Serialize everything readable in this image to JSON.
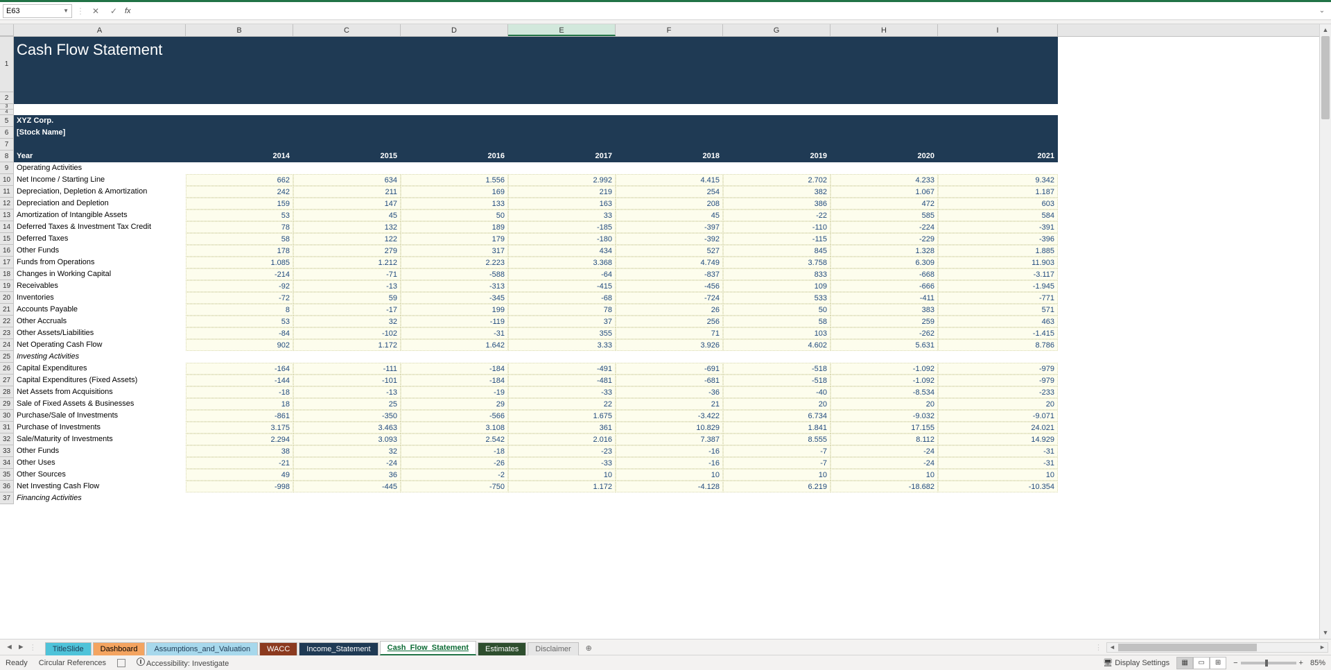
{
  "name_box": "E63",
  "formula_value": "",
  "columns": [
    "A",
    "B",
    "C",
    "D",
    "E",
    "F",
    "G",
    "H",
    "I"
  ],
  "active_column": "E",
  "title": "Cash Flow Statement",
  "company": "XYZ Corp.",
  "stock_label": "[Stock Name]",
  "year_label": "Year",
  "years": [
    "2014",
    "2015",
    "2016",
    "2017",
    "2018",
    "2019",
    "2020",
    "2021"
  ],
  "sections": {
    "operating": "Operating Activities",
    "investing": "Investing Activities",
    "financing": "Financing Activities"
  },
  "rows": [
    {
      "n": 10,
      "label": "Net Income / Starting Line",
      "vals": [
        "662",
        "634",
        "1.556",
        "2.992",
        "4.415",
        "2.702",
        "4.233",
        "9.342"
      ]
    },
    {
      "n": 11,
      "label": "Depreciation, Depletion & Amortization",
      "vals": [
        "242",
        "211",
        "169",
        "219",
        "254",
        "382",
        "1.067",
        "1.187"
      ]
    },
    {
      "n": 12,
      "label": "Depreciation and Depletion",
      "vals": [
        "159",
        "147",
        "133",
        "163",
        "208",
        "386",
        "472",
        "603"
      ]
    },
    {
      "n": 13,
      "label": "Amortization of Intangible Assets",
      "vals": [
        "53",
        "45",
        "50",
        "33",
        "45",
        "-22",
        "585",
        "584"
      ]
    },
    {
      "n": 14,
      "label": "Deferred Taxes & Investment Tax Credit",
      "vals": [
        "78",
        "132",
        "189",
        "-185",
        "-397",
        "-110",
        "-224",
        "-391"
      ]
    },
    {
      "n": 15,
      "label": "Deferred Taxes",
      "vals": [
        "58",
        "122",
        "179",
        "-180",
        "-392",
        "-115",
        "-229",
        "-396"
      ]
    },
    {
      "n": 16,
      "label": "Other Funds",
      "vals": [
        "178",
        "279",
        "317",
        "434",
        "527",
        "845",
        "1.328",
        "1.885"
      ]
    },
    {
      "n": 17,
      "label": "Funds from Operations",
      "vals": [
        "1.085",
        "1.212",
        "2.223",
        "3.368",
        "4.749",
        "3.758",
        "6.309",
        "11.903"
      ]
    },
    {
      "n": 18,
      "label": "Changes in Working Capital",
      "vals": [
        "-214",
        "-71",
        "-588",
        "-64",
        "-837",
        "833",
        "-668",
        "-3.117"
      ]
    },
    {
      "n": 19,
      "label": "Receivables",
      "vals": [
        "-92",
        "-13",
        "-313",
        "-415",
        "-456",
        "109",
        "-666",
        "-1.945"
      ]
    },
    {
      "n": 20,
      "label": "Inventories",
      "vals": [
        "-72",
        "59",
        "-345",
        "-68",
        "-724",
        "533",
        "-411",
        "-771"
      ]
    },
    {
      "n": 21,
      "label": "Accounts Payable",
      "vals": [
        "8",
        "-17",
        "199",
        "78",
        "26",
        "50",
        "383",
        "571"
      ]
    },
    {
      "n": 22,
      "label": "Other Accruals",
      "vals": [
        "53",
        "32",
        "-119",
        "37",
        "256",
        "58",
        "259",
        "463"
      ]
    },
    {
      "n": 23,
      "label": "Other Assets/Liabilities",
      "vals": [
        "-84",
        "-102",
        "-31",
        "355",
        "71",
        "103",
        "-262",
        "-1.415"
      ]
    },
    {
      "n": 24,
      "label": "Net Operating Cash Flow",
      "vals": [
        "902",
        "1.172",
        "1.642",
        "3.33",
        "3.926",
        "4.602",
        "5.631",
        "8.786"
      ]
    }
  ],
  "rows_inv": [
    {
      "n": 26,
      "label": "Capital Expenditures",
      "vals": [
        "-164",
        "-111",
        "-184",
        "-491",
        "-691",
        "-518",
        "-1.092",
        "-979"
      ]
    },
    {
      "n": 27,
      "label": "Capital Expenditures (Fixed Assets)",
      "vals": [
        "-144",
        "-101",
        "-184",
        "-481",
        "-681",
        "-518",
        "-1.092",
        "-979"
      ]
    },
    {
      "n": 28,
      "label": "Net Assets from Acquisitions",
      "vals": [
        "-18",
        "-13",
        "-19",
        "-33",
        "-36",
        "-40",
        "-8.534",
        "-233"
      ]
    },
    {
      "n": 29,
      "label": "Sale of Fixed Assets & Businesses",
      "vals": [
        "18",
        "25",
        "29",
        "22",
        "21",
        "20",
        "20",
        "20"
      ]
    },
    {
      "n": 30,
      "label": "Purchase/Sale of Investments",
      "vals": [
        "-861",
        "-350",
        "-566",
        "1.675",
        "-3.422",
        "6.734",
        "-9.032",
        "-9.071"
      ]
    },
    {
      "n": 31,
      "label": "Purchase of Investments",
      "vals": [
        "3.175",
        "3.463",
        "3.108",
        "361",
        "10.829",
        "1.841",
        "17.155",
        "24.021"
      ]
    },
    {
      "n": 32,
      "label": "Sale/Maturity of Investments",
      "vals": [
        "2.294",
        "3.093",
        "2.542",
        "2.016",
        "7.387",
        "8.555",
        "8.112",
        "14.929"
      ]
    },
    {
      "n": 33,
      "label": "Other Funds",
      "vals": [
        "38",
        "32",
        "-18",
        "-23",
        "-16",
        "-7",
        "-24",
        "-31"
      ]
    },
    {
      "n": 34,
      "label": "Other Uses",
      "vals": [
        "-21",
        "-24",
        "-26",
        "-33",
        "-16",
        "-7",
        "-24",
        "-31"
      ]
    },
    {
      "n": 35,
      "label": "Other Sources",
      "vals": [
        "49",
        "36",
        "-2",
        "10",
        "10",
        "10",
        "10",
        "10"
      ]
    },
    {
      "n": 36,
      "label": "Net Investing Cash Flow",
      "vals": [
        "-998",
        "-445",
        "-750",
        "1.172",
        "-4.128",
        "6.219",
        "-18.682",
        "-10.354"
      ]
    }
  ],
  "tabs": [
    {
      "id": "title-slide",
      "label": "TitleSlide"
    },
    {
      "id": "dashboard",
      "label": "Dashboard"
    },
    {
      "id": "assumptions",
      "label": "Assumptions_and_Valuation"
    },
    {
      "id": "wacc",
      "label": "WACC"
    },
    {
      "id": "income",
      "label": "Income_Statement"
    },
    {
      "id": "cashflow",
      "label": "Cash_Flow_Statement"
    },
    {
      "id": "estimates",
      "label": "Estimates"
    },
    {
      "id": "disclaimer",
      "label": "Disclaimer"
    }
  ],
  "active_tab": "cashflow",
  "status": {
    "ready": "Ready",
    "circular": "Circular References",
    "accessibility": "Accessibility: Investigate",
    "display_settings": "Display Settings",
    "zoom": "85%"
  }
}
